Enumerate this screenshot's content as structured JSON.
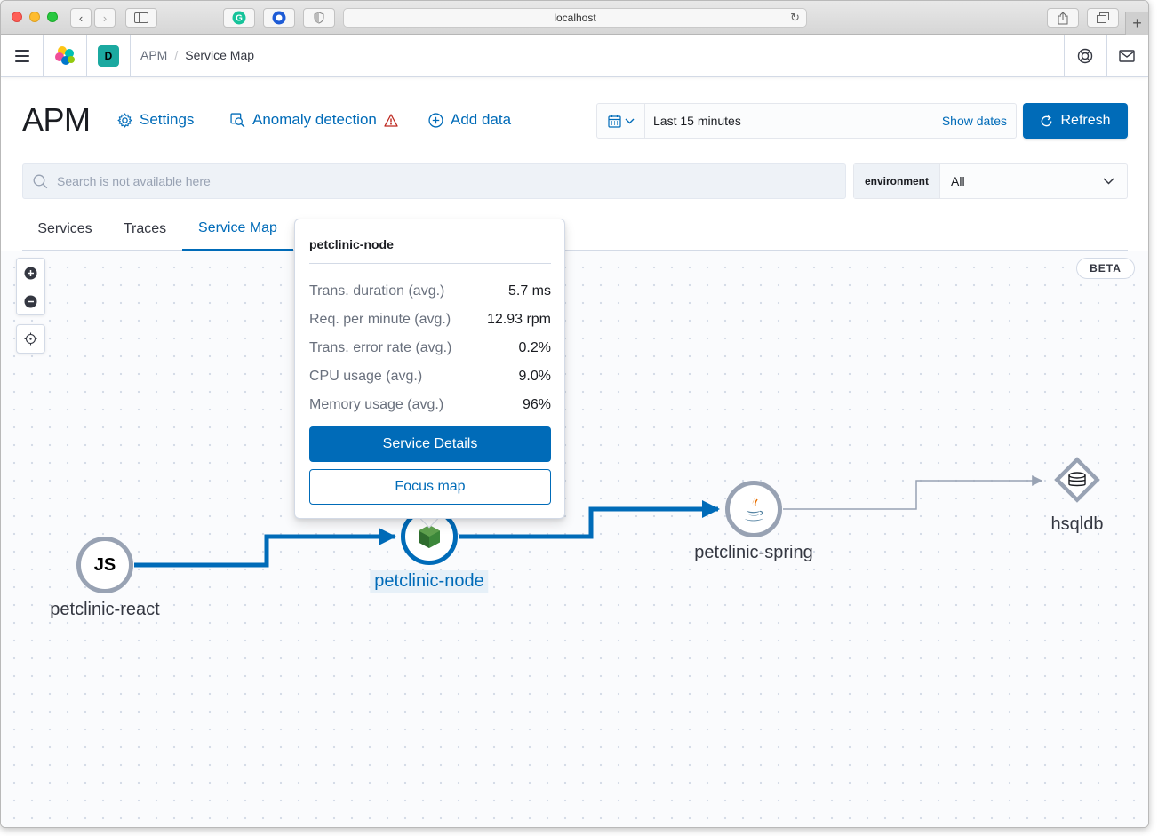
{
  "browser": {
    "url": "localhost"
  },
  "breadcrumbs": {
    "space_initial": "D",
    "root": "APM",
    "separator": "/",
    "current": "Service Map"
  },
  "header": {
    "title": "APM",
    "settings_label": "Settings",
    "anomaly_label": "Anomaly detection",
    "add_data_label": "Add data"
  },
  "datepicker": {
    "range": "Last 15 minutes",
    "show_dates": "Show dates",
    "refresh_label": "Refresh"
  },
  "search": {
    "placeholder": "Search is not available here"
  },
  "environment": {
    "label": "environment",
    "value": "All"
  },
  "tabs": [
    {
      "label": "Services",
      "active": false
    },
    {
      "label": "Traces",
      "active": false
    },
    {
      "label": "Service Map",
      "active": true
    }
  ],
  "map": {
    "badge": "BETA",
    "nodes": [
      {
        "name": "petclinic-react",
        "icon": "JS",
        "kind": "rum-js"
      },
      {
        "name": "petclinic-node",
        "icon": "nodejs-icon",
        "kind": "service",
        "selected": true
      },
      {
        "name": "petclinic-spring",
        "icon": "java-icon",
        "kind": "service"
      },
      {
        "name": "hsqldb",
        "icon": "database-icon",
        "kind": "database"
      }
    ]
  },
  "popover": {
    "title": "petclinic-node",
    "metrics": [
      {
        "label": "Trans. duration (avg.)",
        "value": "5.7 ms"
      },
      {
        "label": "Req. per minute (avg.)",
        "value": "12.93 rpm"
      },
      {
        "label": "Trans. error rate (avg.)",
        "value": "0.2%"
      },
      {
        "label": "CPU usage (avg.)",
        "value": "9.0%"
      },
      {
        "label": "Memory usage (avg.)",
        "value": "96%"
      }
    ],
    "primary_button": "Service Details",
    "secondary_button": "Focus map"
  },
  "colors": {
    "accent": "#006bb8",
    "node_border": "#98a2b3",
    "warning": "#bd271e",
    "nodejs_green": "#3c873a"
  }
}
